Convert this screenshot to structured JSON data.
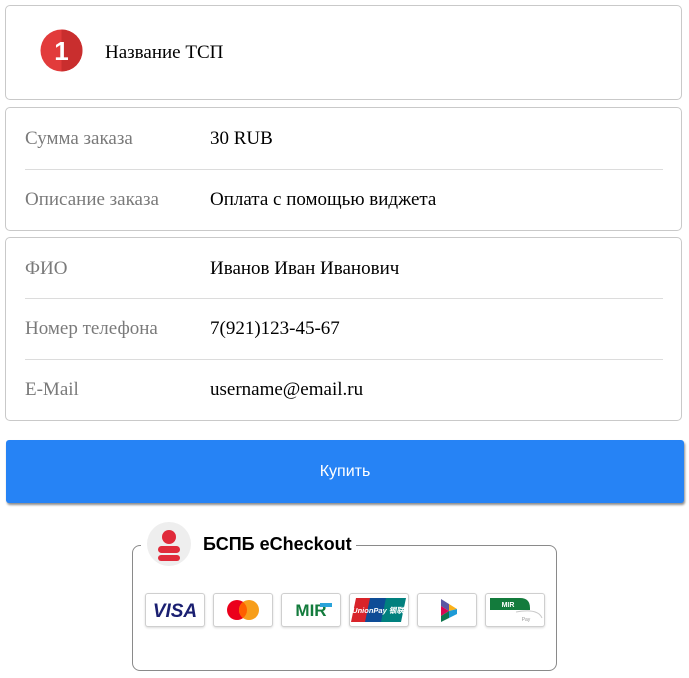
{
  "merchant": {
    "badge_number": "1",
    "name": "Название ТСП"
  },
  "order": {
    "amount_label": "Сумма заказа",
    "amount_value": "30 RUB",
    "description_label": "Описание заказа",
    "description_value": "Оплата с помощью виджета"
  },
  "customer": {
    "name_label": "ФИО",
    "name_value": "Иванов Иван Иванович",
    "phone_label": "Номер телефона",
    "phone_value": "7(921)123-45-67",
    "email_label": "E-Mail",
    "email_value": "username@email.ru"
  },
  "buy_button_label": "Купить",
  "brand": {
    "title": "БСПБ eCheckout"
  },
  "payment_methods": [
    {
      "name": "visa",
      "label": "VISA"
    },
    {
      "name": "mastercard",
      "label": ""
    },
    {
      "name": "mir",
      "label": "MIR"
    },
    {
      "name": "unionpay",
      "label": "UnionPay 银联"
    },
    {
      "name": "sbp",
      "label": ""
    },
    {
      "name": "mir-pay",
      "label": "MIR Pay"
    }
  ],
  "colors": {
    "accent": "#2683f5",
    "brand_red": "#e23b3b",
    "label_gray": "#7a7a7a",
    "border": "#c9c9c9"
  }
}
